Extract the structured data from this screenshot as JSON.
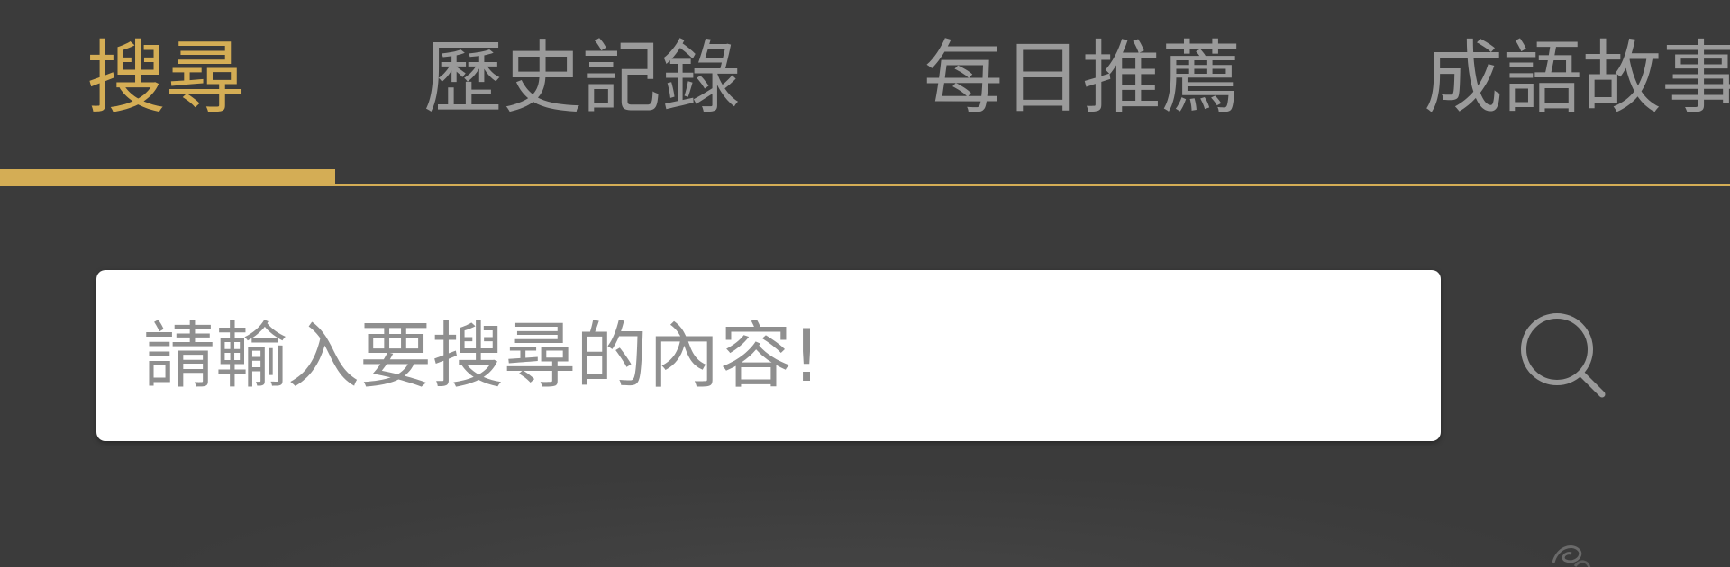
{
  "tabs": [
    {
      "label": "搜尋",
      "active": true
    },
    {
      "label": "歷史記錄",
      "active": false
    },
    {
      "label": "每日推薦",
      "active": false
    },
    {
      "label": "成語故事",
      "active": false
    }
  ],
  "search": {
    "placeholder": "請輸入要搜尋的內容!",
    "value": "",
    "icon": "search-icon"
  },
  "colors": {
    "background": "#3b3b3b",
    "accent": "#d4ad55",
    "tab_inactive": "#9a9a9a",
    "input_background": "#ffffff",
    "placeholder": "#8f8f8f"
  }
}
